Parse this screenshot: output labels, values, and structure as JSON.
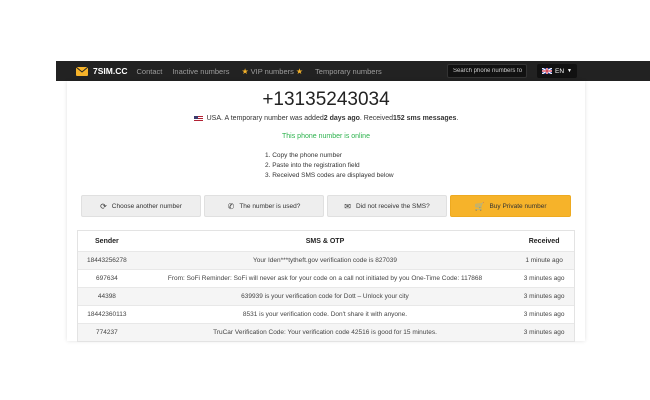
{
  "nav": {
    "brand": "7SIM.CC",
    "links": [
      "Contact",
      "Inactive numbers",
      "VIP numbers",
      "Temporary numbers"
    ],
    "search_placeholder": "Search phone numbers fo",
    "lang": "EN",
    "accent": "#f6b32a"
  },
  "number": {
    "phone": "+13135243034",
    "country": "USA",
    "info_pre": ". A temporary number was added ",
    "added": "2 days ago",
    "info_mid": ". Received ",
    "count": "152 sms messages",
    "info_end": ".",
    "status": "This phone number is online",
    "status_color": "#2bb24c"
  },
  "steps": [
    "1. Copy the phone number",
    "2. Paste into the registration field",
    "3. Received SMS codes are displayed below"
  ],
  "buttons": {
    "choose": "Choose another number",
    "used": "The number is used?",
    "not_received": "Did not receive the SMS?",
    "buy": "Buy Private number"
  },
  "table": {
    "headers": [
      "Sender",
      "SMS & OTP",
      "Received"
    ],
    "rows": [
      [
        "18443256278",
        "Your Iden***tytheft.gov verification code is 827039",
        "1 minute ago"
      ],
      [
        "697634",
        "From: SoFi Reminder: SoFi will never ask for your code on a call not initiated by you One-Time Code: 117868",
        "3 minutes ago"
      ],
      [
        "44398",
        "639939 is your verification code for Dott – Unlock your city",
        "3 minutes ago"
      ],
      [
        "18442360113",
        "8531 is your verification code. Don't share it with anyone.",
        "3 minutes ago"
      ],
      [
        "774237",
        "TruCar Verification Code: Your verification code 42516 is good for 15 minutes.",
        "3 minutes ago"
      ]
    ]
  }
}
